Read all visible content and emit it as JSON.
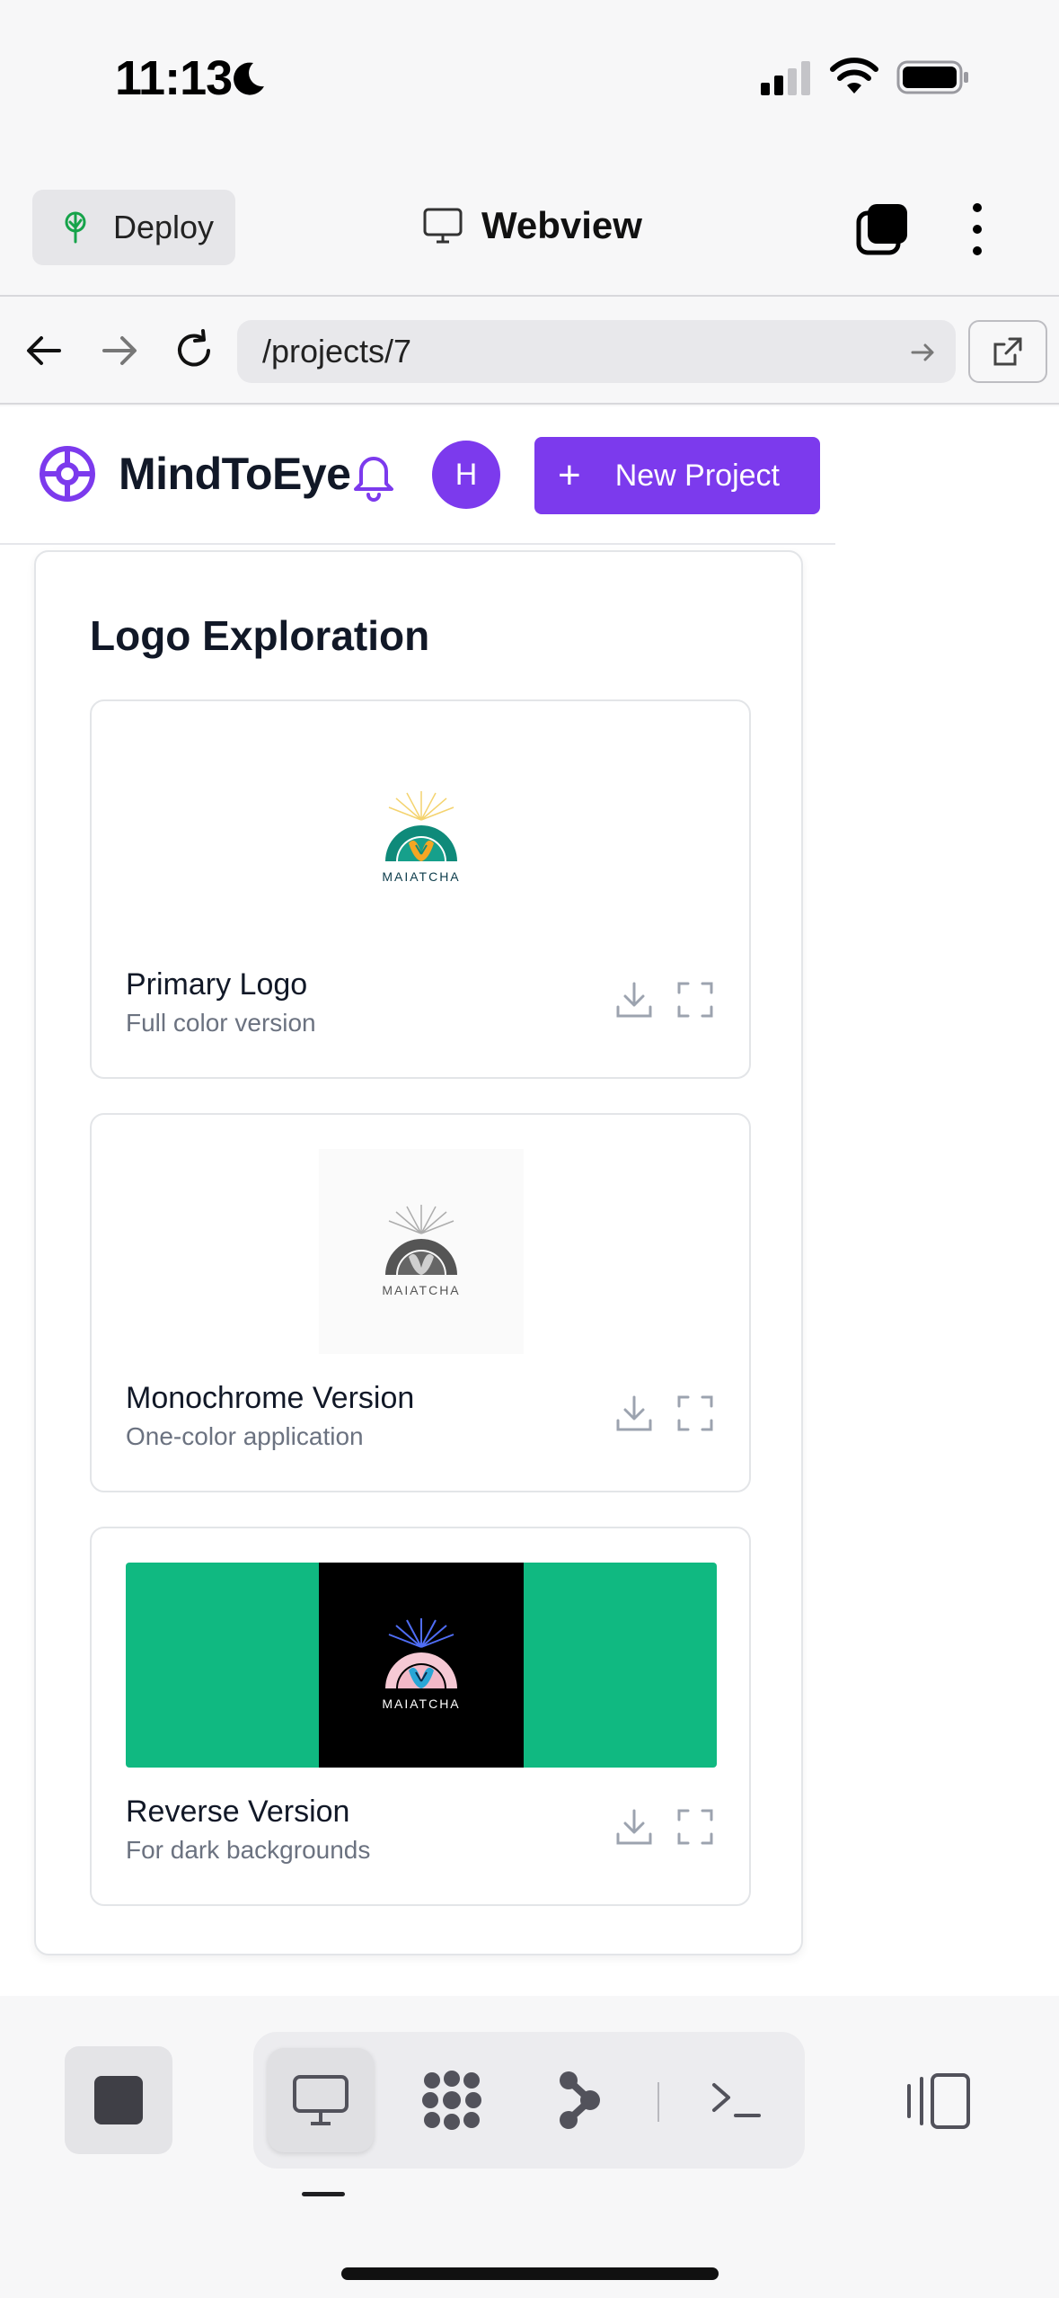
{
  "status_bar": {
    "time": "11:13",
    "icons": [
      "moon-icon",
      "cellular-signal-icon",
      "wifi-icon",
      "battery-icon"
    ]
  },
  "app_bar": {
    "deploy_label": "Deploy",
    "title": "Webview",
    "icons": [
      "deploy-tree-icon",
      "monitor-icon",
      "tabs-icon",
      "more-vertical-icon"
    ]
  },
  "url_bar": {
    "url": "/projects/7",
    "icons": [
      "back-arrow-icon",
      "forward-arrow-icon",
      "reload-icon",
      "go-arrow-icon",
      "external-link-icon"
    ]
  },
  "site": {
    "brand": "MindToEye",
    "avatar_initial": "H",
    "new_project_label": "New Project",
    "accent": "#7c3aed"
  },
  "section": {
    "title": "Logo Exploration",
    "assets": [
      {
        "name": "Primary Logo",
        "description": "Full color version",
        "logo_text": "MAIATCHA",
        "variant": "color"
      },
      {
        "name": "Monochrome Version",
        "description": "One-color application",
        "logo_text": "MAIATCHA",
        "variant": "mono"
      },
      {
        "name": "Reverse Version",
        "description": "For dark backgrounds",
        "logo_text": "MAIATCHA",
        "variant": "reverse"
      }
    ],
    "reverse_bg": "#10b981"
  },
  "bottom_bar": {
    "tools": [
      "stop-icon",
      "desktop-icon",
      "apps-grid-icon",
      "branch-icon",
      "terminal-icon",
      "split-view-icon"
    ]
  }
}
